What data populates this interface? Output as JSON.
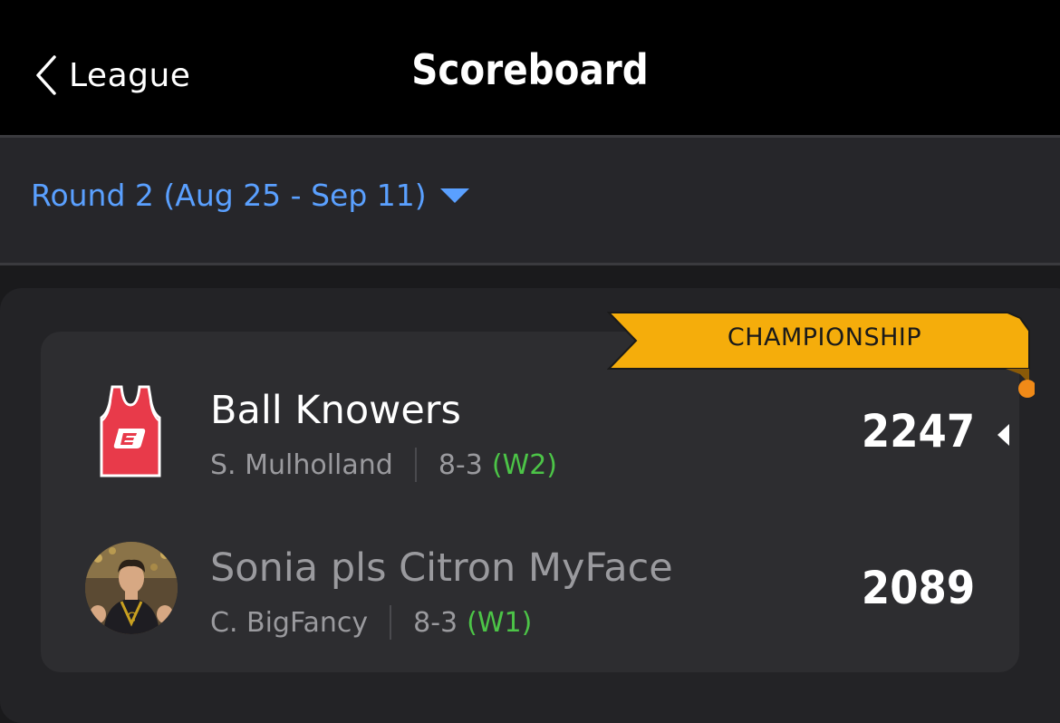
{
  "header": {
    "back_label": "League",
    "title": "Scoreboard"
  },
  "round": {
    "label": "Round 2 (Aug 25 - Sep 11)"
  },
  "matchup": {
    "banner": "CHAMPIONSHIP",
    "teams": [
      {
        "name": "Ball Knowers",
        "manager": "S. Mulholland",
        "record": "8-3",
        "streak": "(W2)",
        "score": "2247",
        "leading": true,
        "logo_icon": "jersey-icon"
      },
      {
        "name": "Sonia pls Citron MyFace",
        "manager": "C. BigFancy",
        "record": "8-3",
        "streak": "(W1)",
        "score": "2089",
        "leading": false,
        "logo_icon": "player-photo-avatar"
      }
    ]
  },
  "colors": {
    "accent": "#5aa0ff",
    "banner": "#f5ad0b",
    "streak": "#4cc447",
    "jersey": "#e83a4a"
  }
}
